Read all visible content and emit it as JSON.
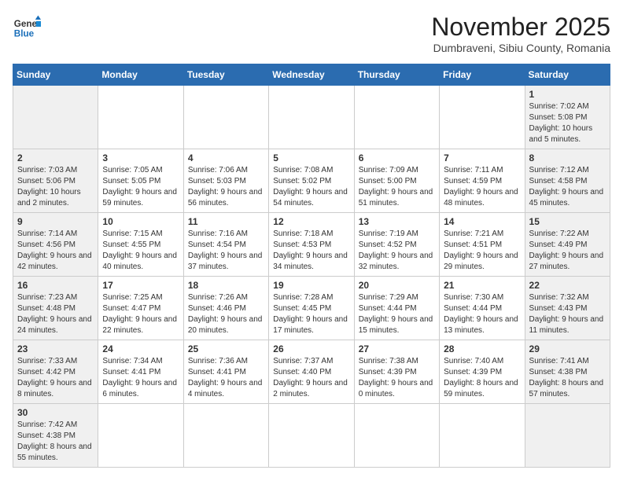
{
  "logo": {
    "general": "General",
    "blue": "Blue"
  },
  "header": {
    "month": "November 2025",
    "location": "Dumbraveni, Sibiu County, Romania"
  },
  "weekdays": [
    "Sunday",
    "Monday",
    "Tuesday",
    "Wednesday",
    "Thursday",
    "Friday",
    "Saturday"
  ],
  "weeks": [
    [
      {
        "day": "",
        "info": ""
      },
      {
        "day": "",
        "info": ""
      },
      {
        "day": "",
        "info": ""
      },
      {
        "day": "",
        "info": ""
      },
      {
        "day": "",
        "info": ""
      },
      {
        "day": "",
        "info": ""
      },
      {
        "day": "1",
        "info": "Sunrise: 7:02 AM\nSunset: 5:08 PM\nDaylight: 10 hours and 5 minutes."
      }
    ],
    [
      {
        "day": "2",
        "info": "Sunrise: 7:03 AM\nSunset: 5:06 PM\nDaylight: 10 hours and 2 minutes."
      },
      {
        "day": "3",
        "info": "Sunrise: 7:05 AM\nSunset: 5:05 PM\nDaylight: 9 hours and 59 minutes."
      },
      {
        "day": "4",
        "info": "Sunrise: 7:06 AM\nSunset: 5:03 PM\nDaylight: 9 hours and 56 minutes."
      },
      {
        "day": "5",
        "info": "Sunrise: 7:08 AM\nSunset: 5:02 PM\nDaylight: 9 hours and 54 minutes."
      },
      {
        "day": "6",
        "info": "Sunrise: 7:09 AM\nSunset: 5:00 PM\nDaylight: 9 hours and 51 minutes."
      },
      {
        "day": "7",
        "info": "Sunrise: 7:11 AM\nSunset: 4:59 PM\nDaylight: 9 hours and 48 minutes."
      },
      {
        "day": "8",
        "info": "Sunrise: 7:12 AM\nSunset: 4:58 PM\nDaylight: 9 hours and 45 minutes."
      }
    ],
    [
      {
        "day": "9",
        "info": "Sunrise: 7:14 AM\nSunset: 4:56 PM\nDaylight: 9 hours and 42 minutes."
      },
      {
        "day": "10",
        "info": "Sunrise: 7:15 AM\nSunset: 4:55 PM\nDaylight: 9 hours and 40 minutes."
      },
      {
        "day": "11",
        "info": "Sunrise: 7:16 AM\nSunset: 4:54 PM\nDaylight: 9 hours and 37 minutes."
      },
      {
        "day": "12",
        "info": "Sunrise: 7:18 AM\nSunset: 4:53 PM\nDaylight: 9 hours and 34 minutes."
      },
      {
        "day": "13",
        "info": "Sunrise: 7:19 AM\nSunset: 4:52 PM\nDaylight: 9 hours and 32 minutes."
      },
      {
        "day": "14",
        "info": "Sunrise: 7:21 AM\nSunset: 4:51 PM\nDaylight: 9 hours and 29 minutes."
      },
      {
        "day": "15",
        "info": "Sunrise: 7:22 AM\nSunset: 4:49 PM\nDaylight: 9 hours and 27 minutes."
      }
    ],
    [
      {
        "day": "16",
        "info": "Sunrise: 7:23 AM\nSunset: 4:48 PM\nDaylight: 9 hours and 24 minutes."
      },
      {
        "day": "17",
        "info": "Sunrise: 7:25 AM\nSunset: 4:47 PM\nDaylight: 9 hours and 22 minutes."
      },
      {
        "day": "18",
        "info": "Sunrise: 7:26 AM\nSunset: 4:46 PM\nDaylight: 9 hours and 20 minutes."
      },
      {
        "day": "19",
        "info": "Sunrise: 7:28 AM\nSunset: 4:45 PM\nDaylight: 9 hours and 17 minutes."
      },
      {
        "day": "20",
        "info": "Sunrise: 7:29 AM\nSunset: 4:44 PM\nDaylight: 9 hours and 15 minutes."
      },
      {
        "day": "21",
        "info": "Sunrise: 7:30 AM\nSunset: 4:44 PM\nDaylight: 9 hours and 13 minutes."
      },
      {
        "day": "22",
        "info": "Sunrise: 7:32 AM\nSunset: 4:43 PM\nDaylight: 9 hours and 11 minutes."
      }
    ],
    [
      {
        "day": "23",
        "info": "Sunrise: 7:33 AM\nSunset: 4:42 PM\nDaylight: 9 hours and 8 minutes."
      },
      {
        "day": "24",
        "info": "Sunrise: 7:34 AM\nSunset: 4:41 PM\nDaylight: 9 hours and 6 minutes."
      },
      {
        "day": "25",
        "info": "Sunrise: 7:36 AM\nSunset: 4:41 PM\nDaylight: 9 hours and 4 minutes."
      },
      {
        "day": "26",
        "info": "Sunrise: 7:37 AM\nSunset: 4:40 PM\nDaylight: 9 hours and 2 minutes."
      },
      {
        "day": "27",
        "info": "Sunrise: 7:38 AM\nSunset: 4:39 PM\nDaylight: 9 hours and 0 minutes."
      },
      {
        "day": "28",
        "info": "Sunrise: 7:40 AM\nSunset: 4:39 PM\nDaylight: 8 hours and 59 minutes."
      },
      {
        "day": "29",
        "info": "Sunrise: 7:41 AM\nSunset: 4:38 PM\nDaylight: 8 hours and 57 minutes."
      }
    ],
    [
      {
        "day": "30",
        "info": "Sunrise: 7:42 AM\nSunset: 4:38 PM\nDaylight: 8 hours and 55 minutes."
      },
      {
        "day": "",
        "info": ""
      },
      {
        "day": "",
        "info": ""
      },
      {
        "day": "",
        "info": ""
      },
      {
        "day": "",
        "info": ""
      },
      {
        "day": "",
        "info": ""
      },
      {
        "day": "",
        "info": ""
      }
    ]
  ]
}
